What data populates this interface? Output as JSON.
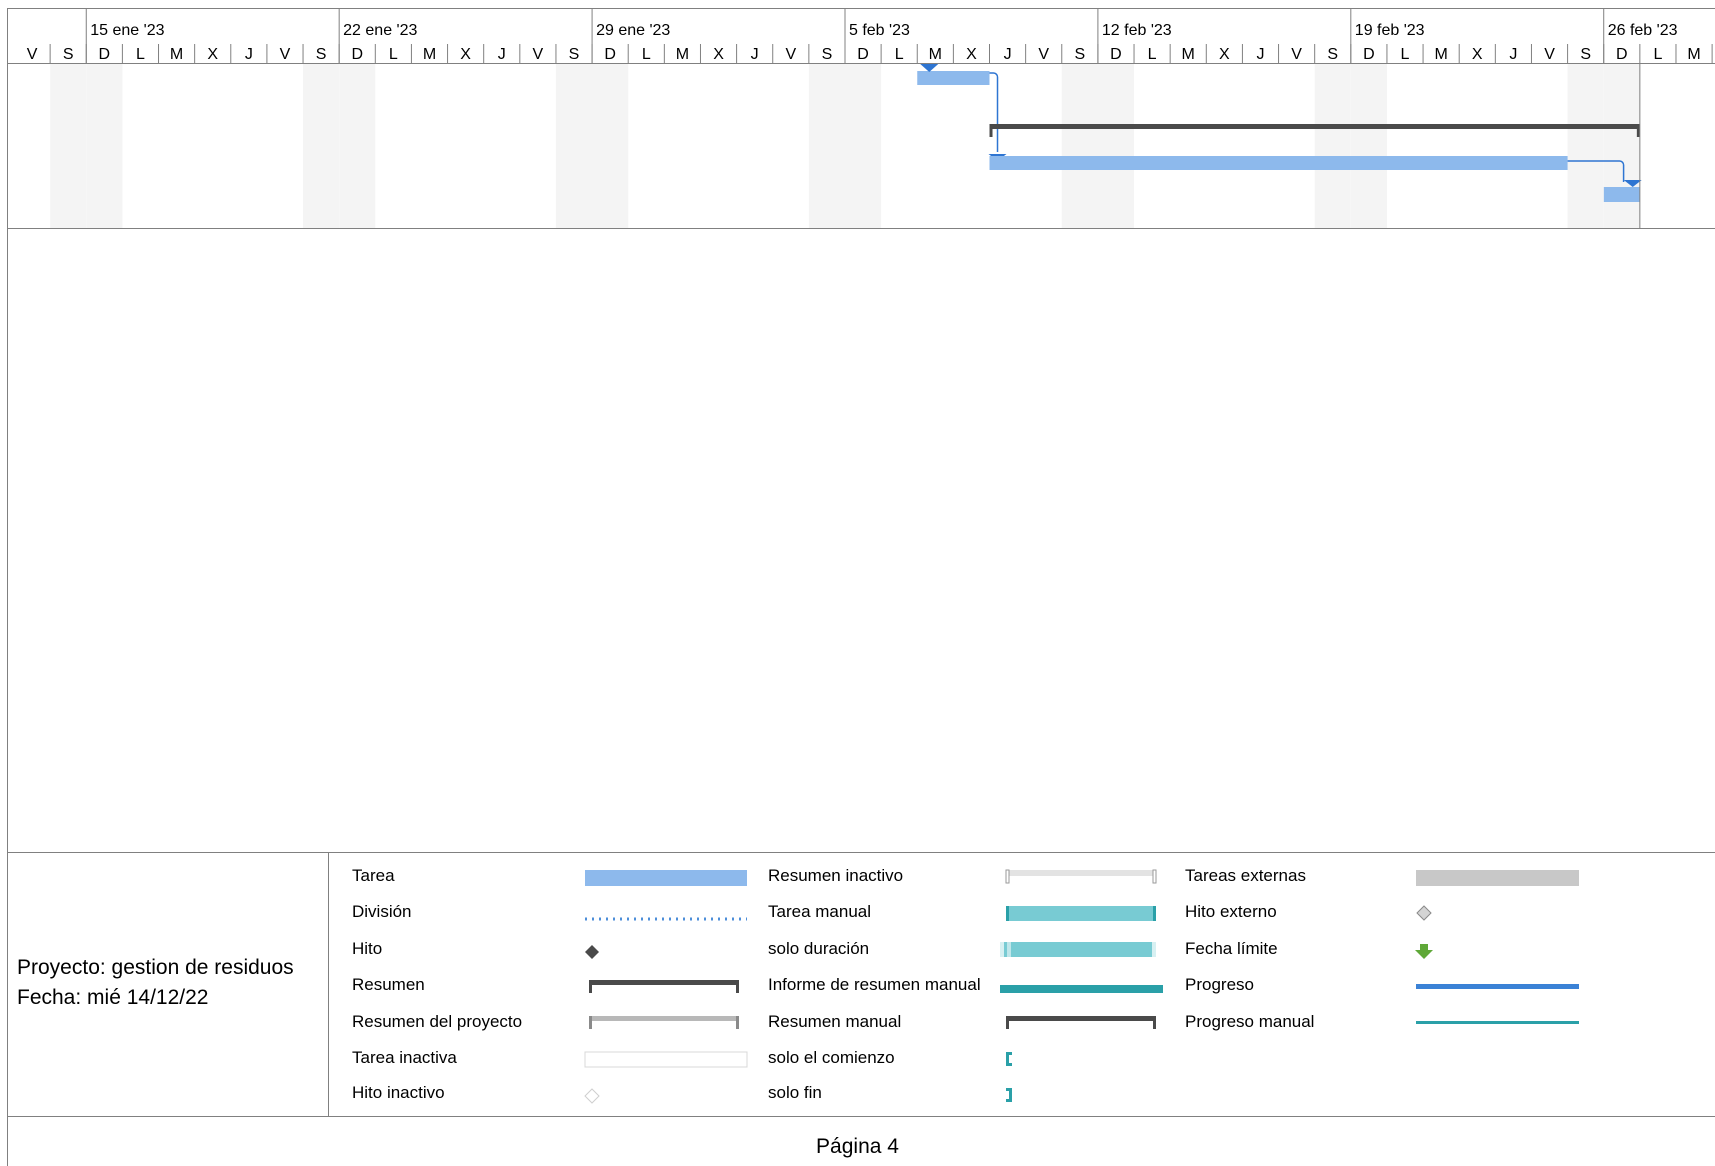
{
  "timescale": {
    "weeks": [
      "15 ene '23",
      "22 ene '23",
      "29 ene '23",
      "5 feb '23",
      "12 feb '23",
      "19 feb '23",
      "26 feb '23"
    ],
    "days": [
      "V",
      "S",
      "D",
      "L",
      "M",
      "X",
      "J",
      "V",
      "S",
      "D",
      "L",
      "M",
      "X",
      "J",
      "V",
      "S",
      "D",
      "L",
      "M",
      "X",
      "J",
      "V",
      "S",
      "D",
      "L",
      "M",
      "X",
      "J",
      "V",
      "S",
      "D",
      "L",
      "M",
      "X",
      "J",
      "V",
      "S",
      "D",
      "L",
      "M",
      "X",
      "J",
      "V",
      "S",
      "D",
      "L",
      "M"
    ]
  },
  "legend": {
    "project_line": "Proyecto: gestion de residuos",
    "date_line": "Fecha: mié 14/12/22",
    "col1": [
      "Tarea",
      "División",
      "Hito",
      "Resumen",
      "Resumen del proyecto",
      "Tarea inactiva",
      "Hito inactivo"
    ],
    "col2": [
      "Resumen inactivo",
      "Tarea manual",
      "solo duración",
      "Informe de resumen manual",
      "Resumen manual",
      "solo el comienzo",
      "solo fin"
    ],
    "col3": [
      "Tareas externas",
      "Hito externo",
      "Fecha límite",
      "Progreso",
      "Progreso manual"
    ]
  },
  "footer": {
    "page_label": "Página 4"
  },
  "colors": {
    "task": "#8DB9EC",
    "summary": "#4A4A4A",
    "link": "#2E75D2",
    "weekend": "#F4F4F4",
    "manual": "#78CBD3",
    "manual_dark": "#2AA0A8",
    "progress": "#3B82D6",
    "external": "#C8C8C8",
    "deadline": "#5FA838"
  }
}
